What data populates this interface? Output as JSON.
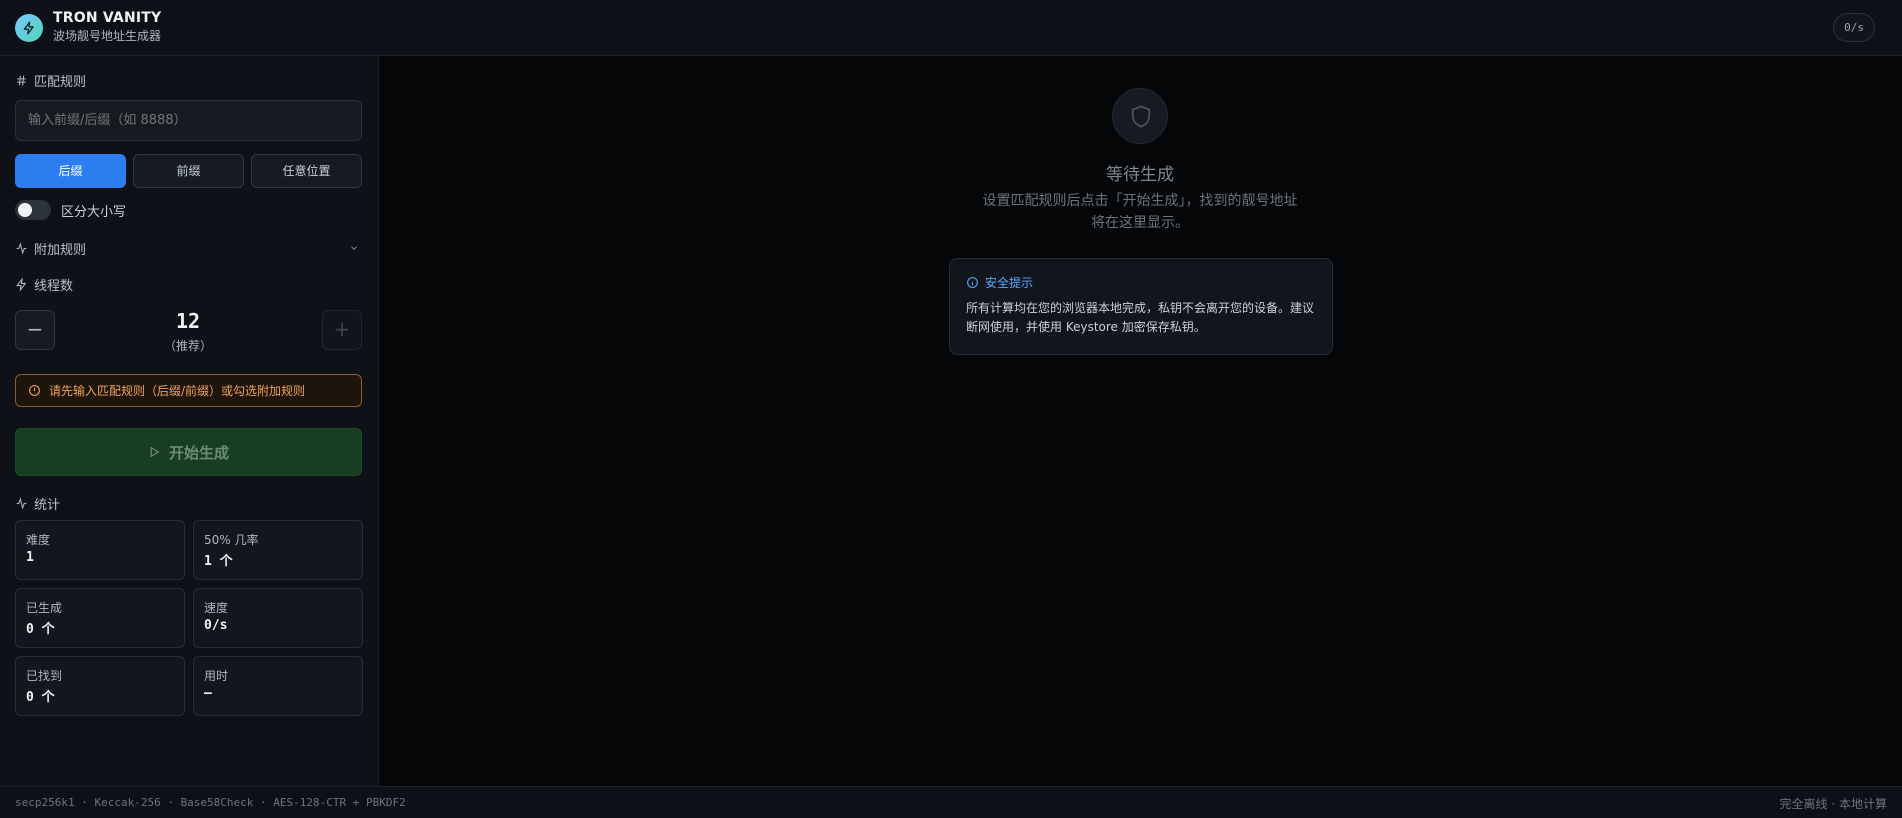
{
  "header": {
    "title": "TRON VANITY",
    "subtitle": "波场靓号地址生成器",
    "speed": "0/s"
  },
  "sidebar": {
    "match_rules_title": "匹配规则",
    "pattern_placeholder": "输入前缀/后缀（如 8888）",
    "modes": [
      "后缀",
      "前缀",
      "任意位置"
    ],
    "active_mode": "后缀",
    "case_sensitive_label": "区分大小写",
    "case_sensitive_on": false,
    "extra_rules_title": "附加规则",
    "threads_title": "线程数",
    "threads_value": "12",
    "threads_note": "（推荐）",
    "decrement_label": "−",
    "increment_label": "+",
    "warning": "请先输入匹配规则（后缀/前缀）或勾选附加规则",
    "start_label": "开始生成",
    "stats_title": "统计",
    "stats": [
      {
        "label": "难度",
        "value": "1"
      },
      {
        "label": "50% 几率",
        "value": "1 个"
      },
      {
        "label": "已生成",
        "value": "0 个"
      },
      {
        "label": "速度",
        "value": "0/s"
      },
      {
        "label": "已找到",
        "value": "0 个"
      },
      {
        "label": "用时",
        "value": "–"
      }
    ]
  },
  "main": {
    "empty_title": "等待生成",
    "empty_desc": "设置匹配规则后点击「开始生成」，找到的靓号地址将在这里显示。",
    "tip_title": "安全提示",
    "tip_body": "所有计算均在您的浏览器本地完成，私钥不会离开您的设备。建议断网使用，并使用 Keystore 加密保存私钥。"
  },
  "footer": {
    "algorithms": "secp256k1 · Keccak-256 · Base58Check · AES-128-CTR + PBKDF2",
    "status": "完全离线 · 本地计算"
  },
  "colors": {
    "accent": "#2c7df0",
    "start_button": "#173d22",
    "warning": "#f0a25a",
    "info": "#58a6ff"
  }
}
